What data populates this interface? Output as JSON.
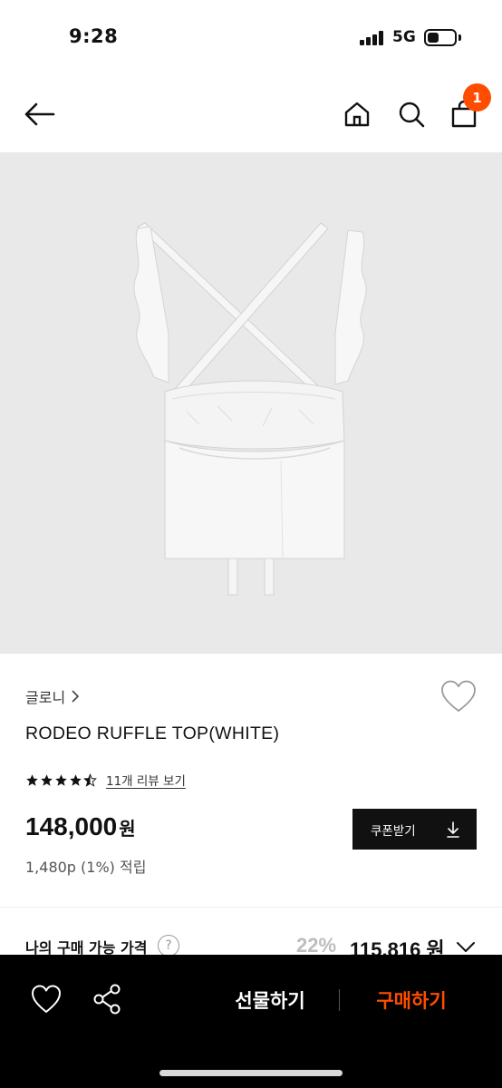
{
  "status_bar": {
    "time": "9:28",
    "network": "5G"
  },
  "nav": {
    "cart_count": "1"
  },
  "product": {
    "brand": "글로니",
    "name": "RODEO RUFFLE TOP(WHITE)",
    "rating": 4.5,
    "review_link": "11개 리뷰 보기",
    "price": "148,000",
    "price_unit": "원",
    "points": "1,480p (1%) 적립"
  },
  "coupon": {
    "label": "쿠폰받기"
  },
  "my_price": {
    "label": "나의 구매 가능 가격",
    "help": "?",
    "discount": "22%",
    "price": "115,816 원"
  },
  "bottom_bar": {
    "gift_label": "선물하기",
    "buy_label": "구매하기"
  },
  "colors": {
    "accent": "#ff4d00",
    "bar": "#000000",
    "image_bg": "#e9e9e9"
  }
}
